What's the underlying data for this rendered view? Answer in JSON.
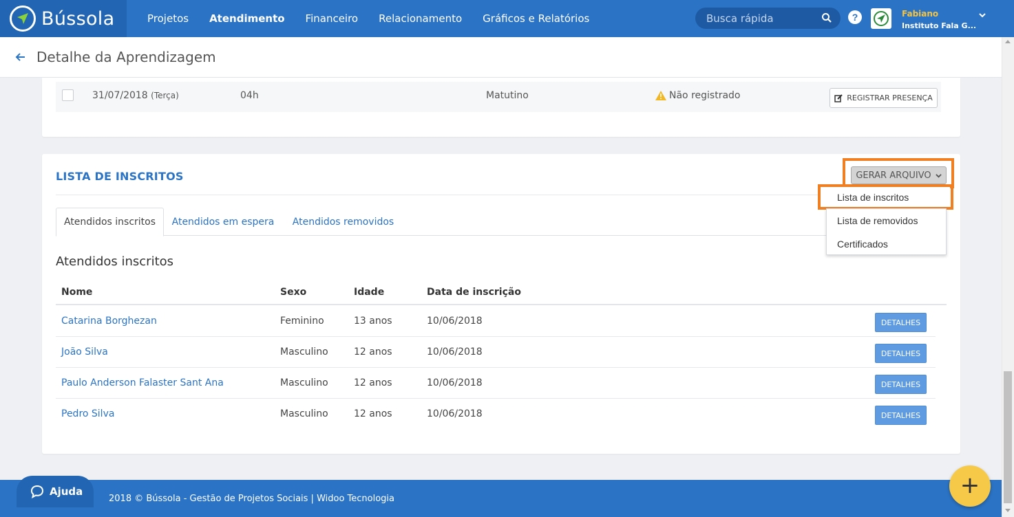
{
  "nav": {
    "brand": "Bússola",
    "items": [
      "Projetos",
      "Atendimento",
      "Financeiro",
      "Relacionamento",
      "Gráficos e Relatórios"
    ],
    "active": "Atendimento",
    "search_placeholder": "Busca rápida",
    "user_name": "Fabiano",
    "user_org": "Instituto Fala G...",
    "help": "?"
  },
  "header": {
    "title": "Detalhe da Aprendizagem"
  },
  "presence_row": {
    "date": "31/07/2018",
    "weekday": "(Terça)",
    "hours": "04h",
    "shift": "Matutino",
    "status": "Não registrado",
    "button": "REGISTRAR PRESENÇA"
  },
  "enrolled": {
    "section_title": "LISTA DE INSCRITOS",
    "generate_button": "GERAR ARQUIVO",
    "dropdown": [
      "Lista de inscritos",
      "Lista de removidos",
      "Certificados"
    ],
    "tabs": [
      "Atendidos inscritos",
      "Atendidos em espera",
      "Atendidos removidos"
    ],
    "subtitle": "Atendidos inscritos",
    "columns": [
      "Nome",
      "Sexo",
      "Idade",
      "Data de inscrição"
    ],
    "details_label": "DETALHES",
    "rows": [
      {
        "name": "Catarina Borghezan",
        "sex": "Feminino",
        "age": "13 anos",
        "date": "10/06/2018"
      },
      {
        "name": "João Silva",
        "sex": "Masculino",
        "age": "12 anos",
        "date": "10/06/2018"
      },
      {
        "name": "Paulo Anderson Falaster Sant Ana",
        "sex": "Masculino",
        "age": "12 anos",
        "date": "10/06/2018"
      },
      {
        "name": "Pedro Silva",
        "sex": "Masculino",
        "age": "12 anos",
        "date": "10/06/2018"
      }
    ]
  },
  "footer": {
    "help_label": "Ajuda",
    "text": "2018 © Bússola - Gestão de Projetos Sociais  |  Widoo Tecnologia",
    "fab": "+"
  },
  "colors": {
    "primary": "#2b73c4",
    "highlight": "#f07f24",
    "warning": "#f2b824",
    "fab": "#f7c948"
  }
}
